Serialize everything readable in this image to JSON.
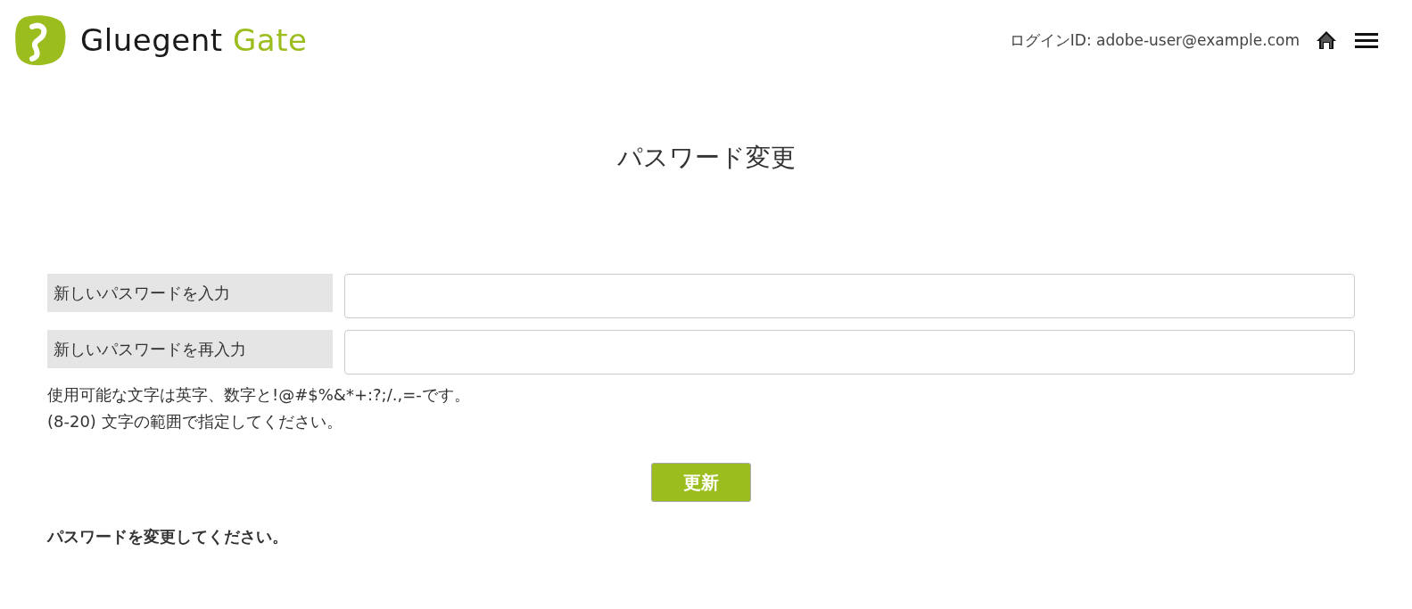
{
  "header": {
    "logo": {
      "brand": "Gluegent",
      "product": "Gate"
    },
    "login_id": "ログインID: adobe-user@example.com"
  },
  "title": "パスワード変更",
  "form": {
    "fields": [
      {
        "label": "新しいパスワードを入力"
      },
      {
        "label": "新しいパスワードを再入力"
      }
    ],
    "help": [
      "使用可能な文字は英字、数字と!@#$%&*+:?;/.,=-です。",
      "(8-20) 文字の範囲で指定してください。"
    ],
    "submit": "更新"
  },
  "message": "パスワードを変更してください。"
}
